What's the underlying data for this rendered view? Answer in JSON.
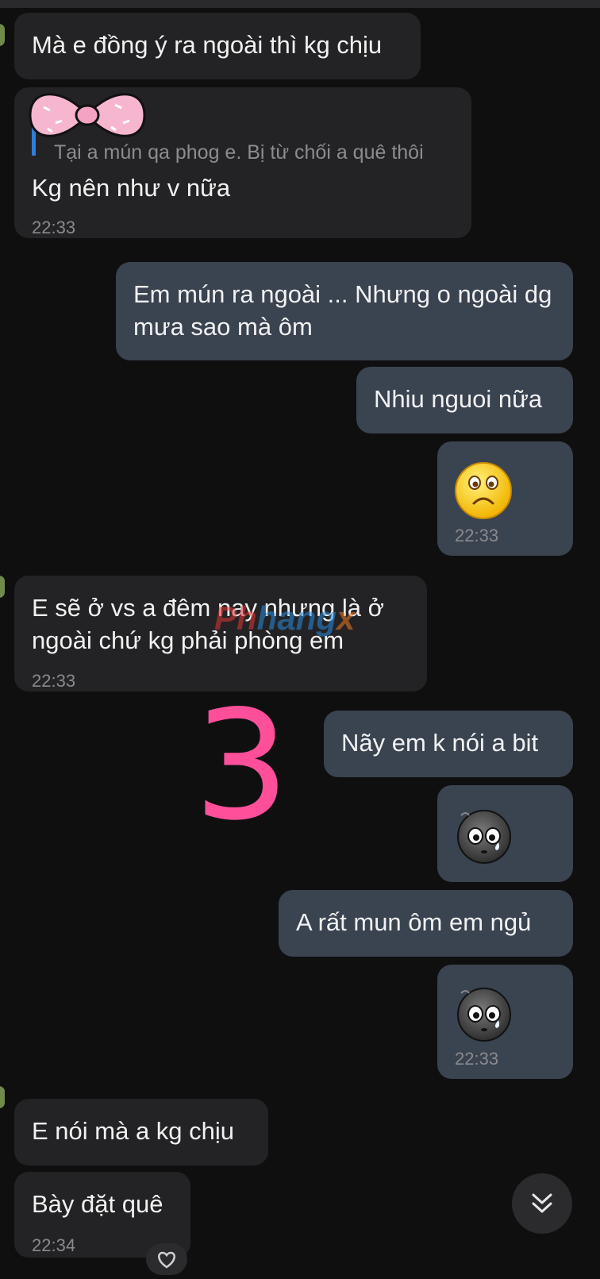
{
  "messages": [
    {
      "text": "Mà e đồng ý ra ngoài thì kg chịu"
    },
    {
      "quote": "Tại a mún qa phog e. Bị từ chối a quê thôi",
      "text": "Kg nên như v nữa",
      "time": "22:33"
    },
    {
      "text": "Em mún ra ngoài ... Nhưng o ngoài dg mưa sao mà ôm"
    },
    {
      "text": "Nhiu nguoi nữa"
    },
    {
      "emoji": "sad-face",
      "time": "22:33"
    },
    {
      "text": "E sẽ ở vs a đêm nay nhưng là ở ngoài chứ kg phải phòng em",
      "time": "22:33"
    },
    {
      "text": "Nãy em k nói a bit"
    },
    {
      "emoji": "gray-tearful-face"
    },
    {
      "text": "A rất mun ôm em ngủ"
    },
    {
      "emoji": "gray-tearful-face",
      "time": "22:33"
    },
    {
      "text": "E nói mà a kg chịu"
    },
    {
      "text": "Bày đặt quê",
      "time": "22:34"
    }
  ],
  "overlay": {
    "number": "3",
    "watermark": {
      "part1": "Ph",
      "part2": "hang",
      "part3": "x"
    }
  },
  "colors": {
    "incoming_bubble": "#232325",
    "outgoing_bubble": "#3a4350",
    "quote_bar": "#2f7ed8",
    "overlay_number": "#ff4f9b"
  },
  "icons": [
    "bow-sticker",
    "chevrons-down-icon",
    "heart-reaction-icon"
  ]
}
